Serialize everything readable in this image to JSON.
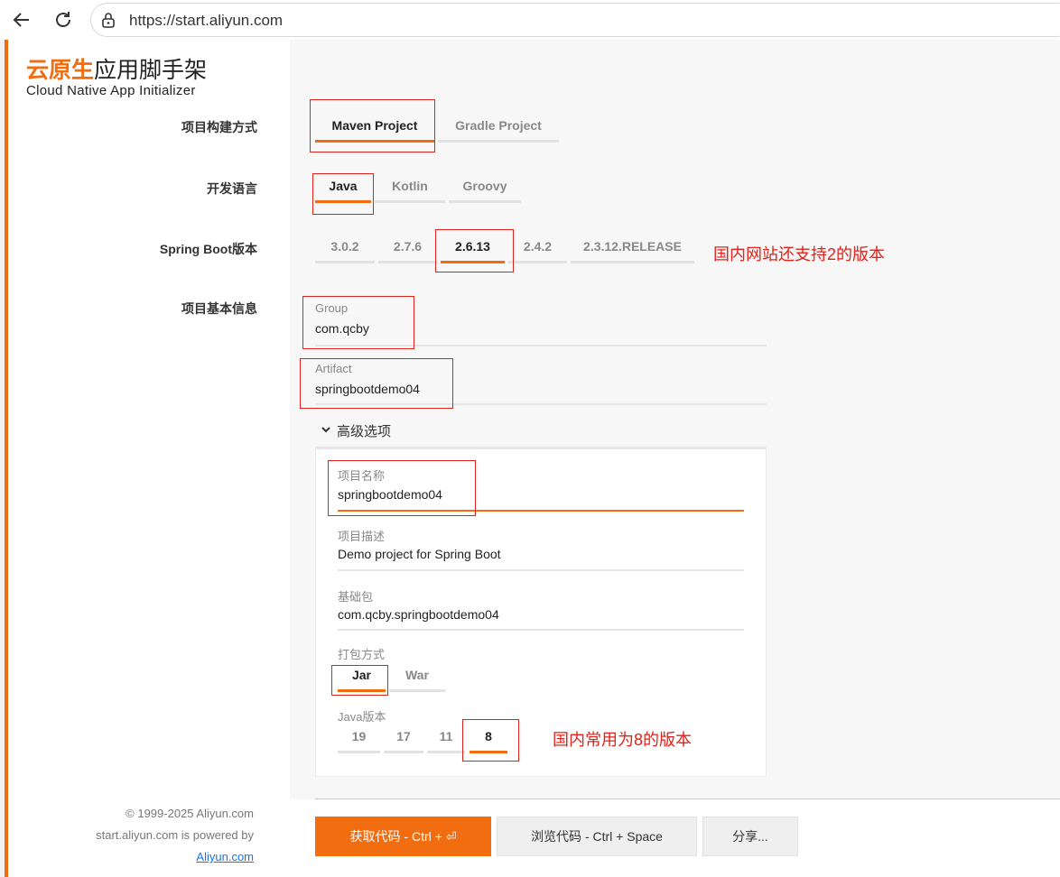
{
  "browser": {
    "url": "https://start.aliyun.com"
  },
  "sidebar": {
    "logo_highlight": "云原生",
    "logo_rest": "应用脚手架",
    "subtitle": "Cloud Native App Initializer",
    "footer_copyright": "© 1999-2025 Aliyun.com",
    "footer_powered": "start.aliyun.com is powered by",
    "footer_link": "Aliyun.com"
  },
  "labels": {
    "build": "项目构建方式",
    "language": "开发语言",
    "boot": "Spring Boot版本",
    "info": "项目基本信息"
  },
  "build_tabs": [
    {
      "label": "Maven Project",
      "selected": true
    },
    {
      "label": "Gradle Project",
      "selected": false
    }
  ],
  "language_tabs": [
    {
      "label": "Java",
      "selected": true
    },
    {
      "label": "Kotlin",
      "selected": false
    },
    {
      "label": "Groovy",
      "selected": false
    }
  ],
  "boot_tabs": [
    {
      "label": "3.0.2",
      "selected": false
    },
    {
      "label": "2.7.6",
      "selected": false
    },
    {
      "label": "2.6.13",
      "selected": true
    },
    {
      "label": "2.4.2",
      "selected": false
    },
    {
      "label": "2.3.12.RELEASE",
      "selected": false
    }
  ],
  "fields": {
    "group": {
      "label": "Group",
      "value": "com.qcby"
    },
    "artifact": {
      "label": "Artifact",
      "value": "springbootdemo04"
    }
  },
  "advanced": {
    "toggle_label": "高级选项",
    "name": {
      "label": "项目名称",
      "value": "springbootdemo04"
    },
    "description": {
      "label": "项目描述",
      "value": "Demo project for Spring Boot"
    },
    "package": {
      "label": "基础包",
      "value": "com.qcby.springbootdemo04"
    },
    "packaging_label": "打包方式",
    "packaging_tabs": [
      {
        "label": "Jar",
        "selected": true
      },
      {
        "label": "War",
        "selected": false
      }
    ],
    "java_label": "Java版本",
    "java_tabs": [
      {
        "label": "19",
        "selected": false
      },
      {
        "label": "17",
        "selected": false
      },
      {
        "label": "11",
        "selected": false
      },
      {
        "label": "8",
        "selected": true
      }
    ]
  },
  "annotations": {
    "boot_note": "国内网站还支持2的版本",
    "java_note": "国内常用为8的版本"
  },
  "buttons": {
    "get_code": "获取代码 - Ctrl + ⏎",
    "browse_code": "浏览代码 - Ctrl + Space",
    "share": "分享..."
  },
  "colors": {
    "accent": "#f26d0f",
    "annotation": "#e0221b"
  }
}
